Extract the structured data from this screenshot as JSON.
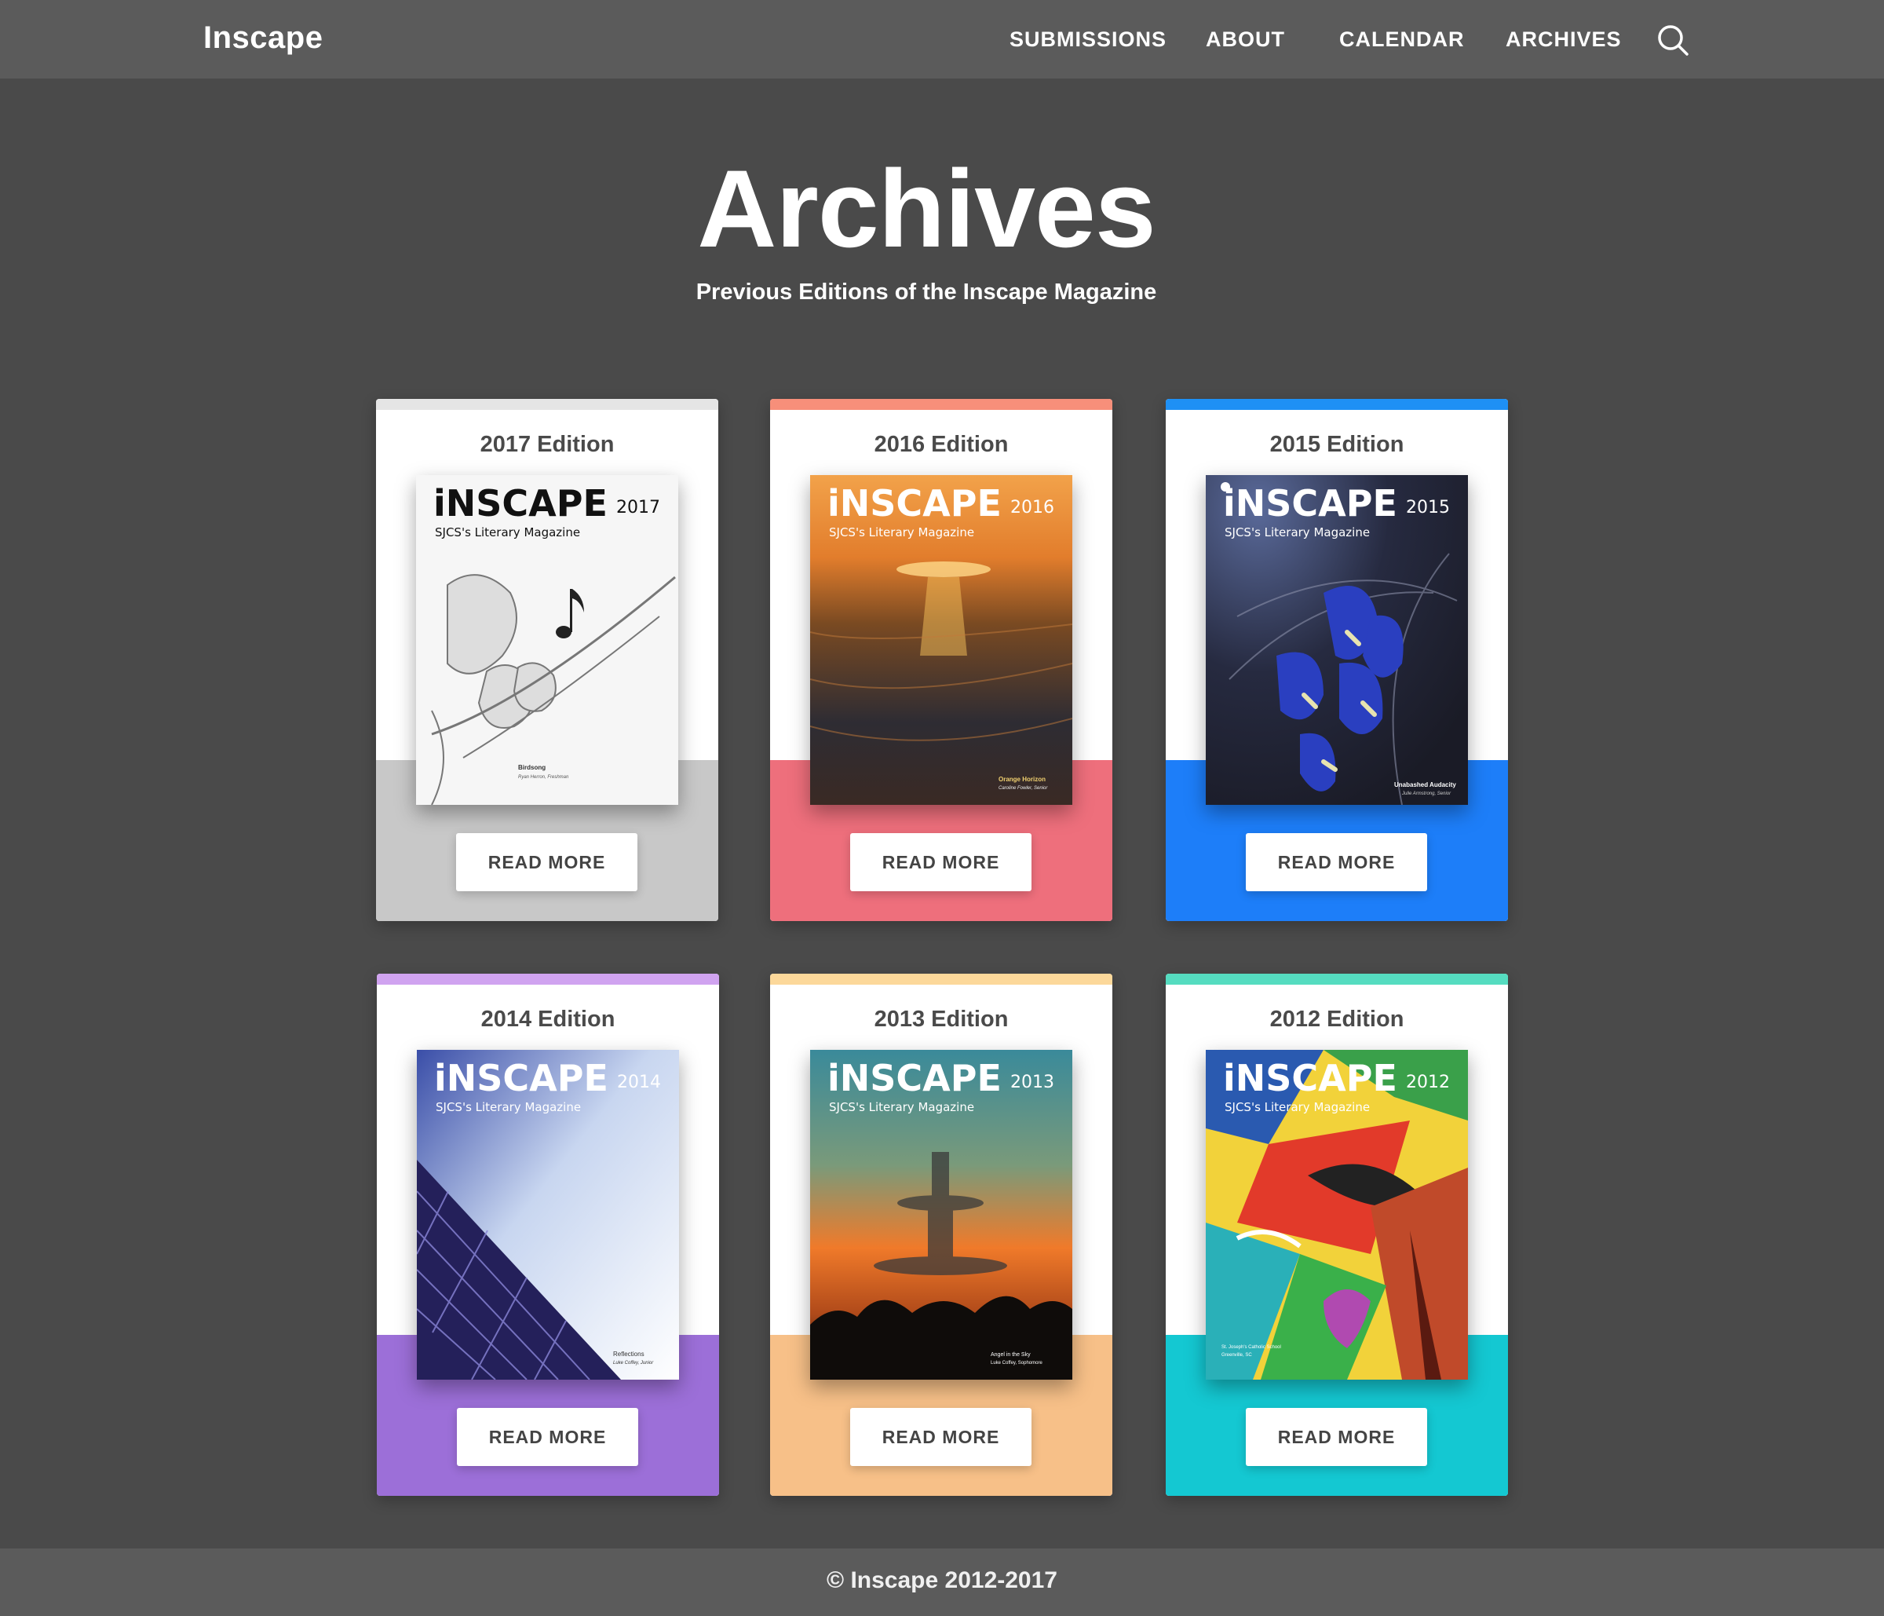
{
  "nav": {
    "brand": "Inscape",
    "links": [
      "SUBMISSIONS",
      "ABOUT",
      "CALENDAR",
      "ARCHIVES"
    ],
    "search_icon": "search-icon"
  },
  "header": {
    "title": "Archives",
    "subtitle": "Previous Editions of the Inscape Magazine"
  },
  "editions": [
    {
      "label": "2017 Edition",
      "cover_title": "iNSCAPE",
      "cover_year": "2017",
      "cover_subtitle": "SJCS's Literary Magazine",
      "cover_caption": "Birdsong",
      "cover_credit": "Ryan Herron, Freshman",
      "button": "READ MORE",
      "accent_top": "#e5e5e5",
      "accent_bottom": "#c8c8c8"
    },
    {
      "label": "2016 Edition",
      "cover_title": "iNSCAPE",
      "cover_year": "2016",
      "cover_subtitle": "SJCS's Literary Magazine",
      "cover_caption": "Orange Horizon",
      "cover_credit": "Caroline Fowler, Senior",
      "button": "READ MORE",
      "accent_top": "#f78f7a",
      "accent_bottom": "#ee6f7c"
    },
    {
      "label": "2015 Edition",
      "cover_title": "iNSCAPE",
      "cover_year": "2015",
      "cover_subtitle": "SJCS's Literary Magazine",
      "cover_caption": "Unabashed Audacity",
      "cover_credit": "Julie Armstrong, Senior",
      "button": "READ MORE",
      "accent_top": "#1e90f5",
      "accent_bottom": "#1d7ef9"
    },
    {
      "label": "2014 Edition",
      "cover_title": "iNSCAPE",
      "cover_year": "2014",
      "cover_subtitle": "SJCS's Literary Magazine",
      "cover_caption": "Reflections",
      "cover_credit": "Luke Coffey, Junior",
      "button": "READ MORE",
      "accent_top": "#d0a3f0",
      "accent_bottom": "#9c6fd8"
    },
    {
      "label": "2013 Edition",
      "cover_title": "iNSCAPE",
      "cover_year": "2013",
      "cover_subtitle": "SJCS's Literary Magazine",
      "cover_caption": "Angel in the Sky",
      "cover_credit": "Luke Coffey, Sophomore",
      "button": "READ MORE",
      "accent_top": "#fcd89a",
      "accent_bottom": "#f7c088"
    },
    {
      "label": "2012 Edition",
      "cover_title": "iNSCAPE",
      "cover_year": "2012",
      "cover_subtitle": "SJCS's Literary Magazine",
      "cover_caption": "St. Joseph's Catholic School",
      "cover_credit": "Greenville, SC",
      "button": "READ MORE",
      "accent_top": "#55dcc0",
      "accent_bottom": "#14c8d2"
    }
  ],
  "footer": {
    "text": "© Inscape 2012-2017"
  }
}
